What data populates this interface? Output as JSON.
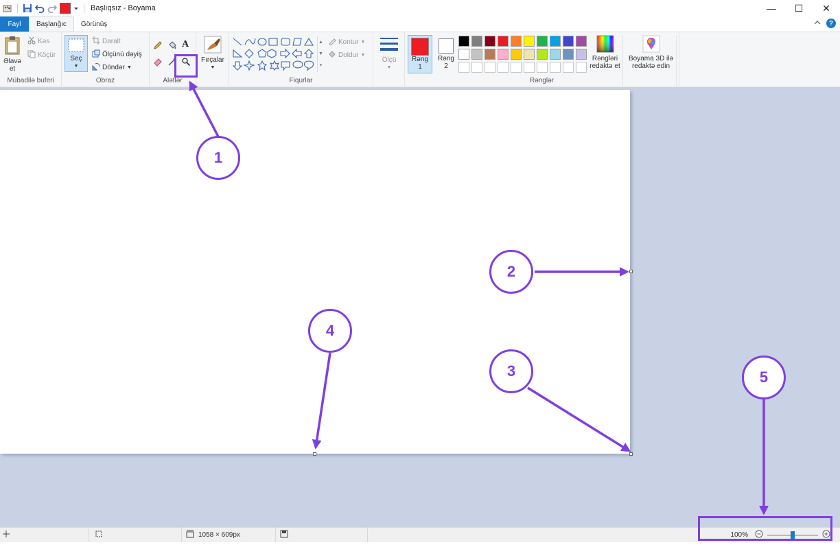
{
  "titlebar": {
    "title": "Başlıqsız - Boyama",
    "window_controls": [
      "—",
      "☐",
      "✕"
    ]
  },
  "tabs": [
    {
      "label": "Fayl"
    },
    {
      "label": "Başlanğıc"
    },
    {
      "label": "Görünüş"
    }
  ],
  "ribbon": {
    "clipboard": {
      "paste_label": "Əlavə et",
      "cut_label": "Kəs",
      "copy_label": "Köçür",
      "group_label": "Mübadilə buferi"
    },
    "image": {
      "select_label": "Seç",
      "crop_label": "Daralt",
      "resize_label": "Ölçünü dəyiş",
      "rotate_label": "Döndər",
      "group_label": "Obraz"
    },
    "tools": {
      "group_label": "Alətlər"
    },
    "brushes": {
      "label": "Fırçalar"
    },
    "shapes": {
      "outline_label": "Kontur",
      "fill_label": "Doldur",
      "group_label": "Fiqurlar"
    },
    "size": {
      "label": "Ölçü"
    },
    "colors": {
      "color1_label": "Rəng 1",
      "color2_label": "Rəng 2",
      "edit_colors_label": "Rəngləri redaktə et",
      "paint3d_label": "Boyama 3D ilə redaktə edin",
      "group_label": "Rənglər",
      "color1": "#ed1c24",
      "color2": "#ffffff",
      "palette": [
        "#000000",
        "#7f7f7f",
        "#880015",
        "#ed1c24",
        "#ff7f27",
        "#fff200",
        "#22b14c",
        "#00a2e8",
        "#3f48cc",
        "#a349a4",
        "#ffffff",
        "#c3c3c3",
        "#b97a57",
        "#ffaec9",
        "#ffc90e",
        "#efe4b0",
        "#b5e61d",
        "#99d9ea",
        "#7092be",
        "#c8bfe7",
        "#ffffff",
        "#ffffff",
        "#ffffff",
        "#ffffff",
        "#ffffff",
        "#ffffff",
        "#ffffff",
        "#ffffff",
        "#ffffff",
        "#ffffff"
      ]
    }
  },
  "status": {
    "dimensions": "1058 × 609px",
    "zoom": "100%",
    "zoom_level_fraction": 0.5
  },
  "annotations": {
    "callouts": [
      "1",
      "2",
      "3",
      "4",
      "5"
    ],
    "accent_color": "#7f3fe0"
  },
  "colors": {
    "workspace": "#c8d2e4",
    "file_tab": "#1979ca"
  }
}
